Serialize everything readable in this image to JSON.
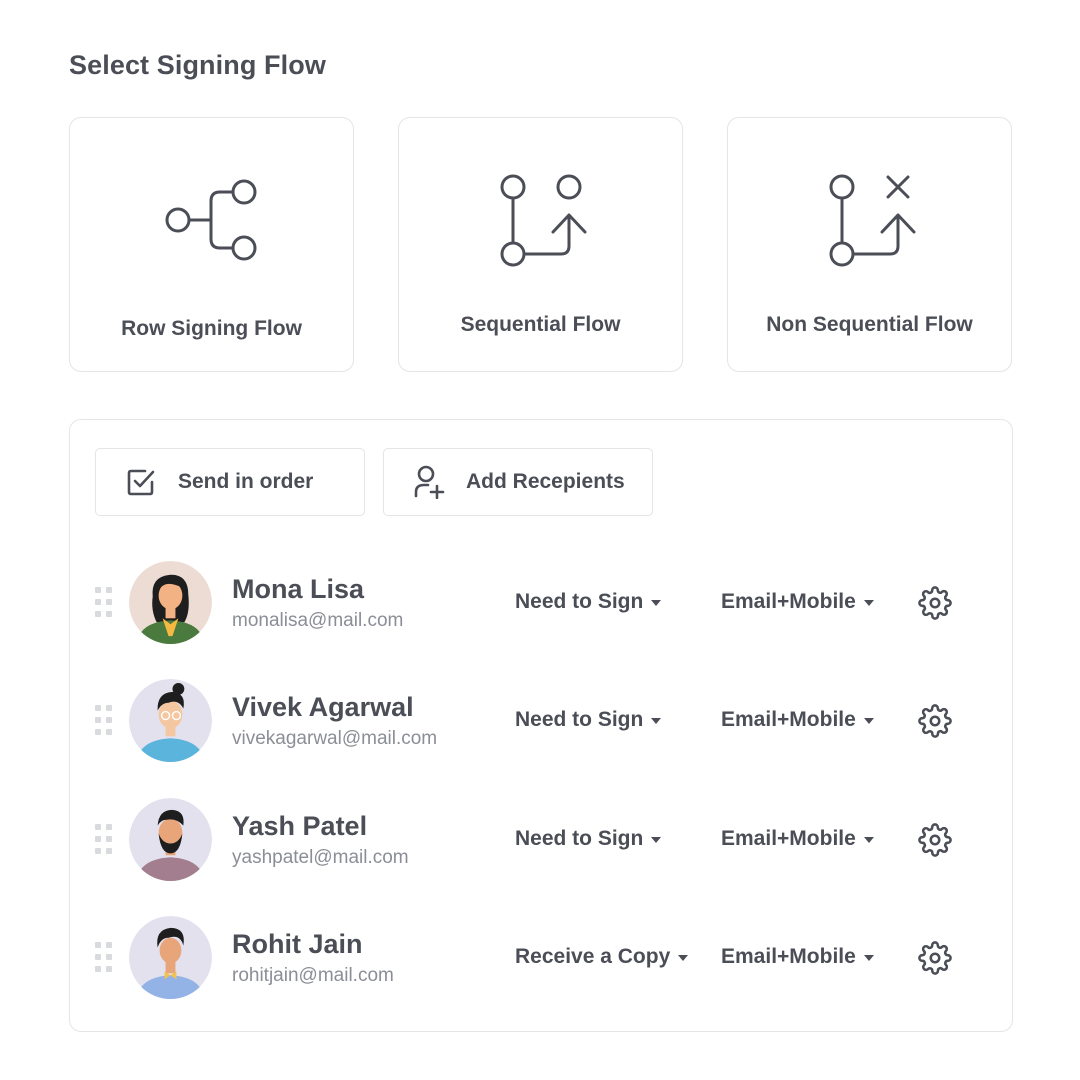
{
  "page": {
    "title": "Select Signing Flow"
  },
  "flows": [
    {
      "label": "Row Signing Flow",
      "icon": "branch-flow-icon"
    },
    {
      "label": "Sequential Flow",
      "icon": "sequential-flow-icon"
    },
    {
      "label": "Non Sequential Flow",
      "icon": "non-sequential-flow-icon"
    }
  ],
  "actions": {
    "send_in_order_label": "Send in order",
    "send_in_order_icon": "checkbox-checked-icon",
    "add_recipients_label": "Add Recepients",
    "add_recipients_icon": "user-plus-icon"
  },
  "recipients": [
    {
      "name": "Mona Lisa",
      "email": "monalisa@mail.com",
      "role": "Need to Sign",
      "delivery": "Email+Mobile"
    },
    {
      "name": "Vivek Agarwal",
      "email": "vivekagarwal@mail.com",
      "role": "Need to Sign",
      "delivery": "Email+Mobile"
    },
    {
      "name": "Yash Patel",
      "email": "yashpatel@mail.com",
      "role": "Need to Sign",
      "delivery": "Email+Mobile"
    },
    {
      "name": "Rohit Jain",
      "email": "rohitjain@mail.com",
      "role": "Receive a Copy",
      "delivery": "Email+Mobile"
    }
  ],
  "colors": {
    "text": "#4b4e56",
    "muted": "#8b8e96",
    "border": "#e4e5e8",
    "handle": "#d9dadd"
  }
}
